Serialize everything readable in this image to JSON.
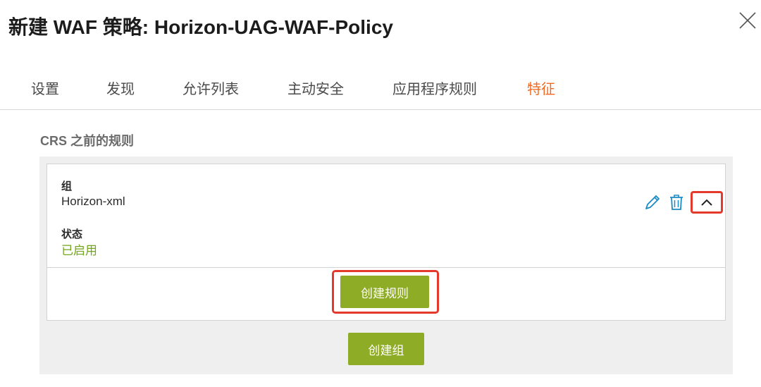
{
  "dialog": {
    "title": "新建 WAF 策略: Horizon-UAG-WAF-Policy"
  },
  "tabs": [
    {
      "label": "设置",
      "active": false
    },
    {
      "label": "发现",
      "active": false
    },
    {
      "label": "允许列表",
      "active": false
    },
    {
      "label": "主动安全",
      "active": false
    },
    {
      "label": "应用程序规则",
      "active": false
    },
    {
      "label": "特征",
      "active": true
    }
  ],
  "section": {
    "title": "CRS 之前的规则"
  },
  "group": {
    "group_label": "组",
    "group_value": "Horizon-xml",
    "status_label": "状态",
    "status_value": "已启用",
    "icons": [
      "pencil-icon",
      "trash-icon",
      "chevron-up-icon"
    ]
  },
  "buttons": {
    "create_rule": "创建规则",
    "create_group": "创建组"
  },
  "colors": {
    "active_tab": "#f26a21",
    "primary_button": "#8fac26",
    "status_enabled": "#72a51c",
    "icon_blue": "#1a8bc5",
    "highlight": "#e33a2c"
  }
}
